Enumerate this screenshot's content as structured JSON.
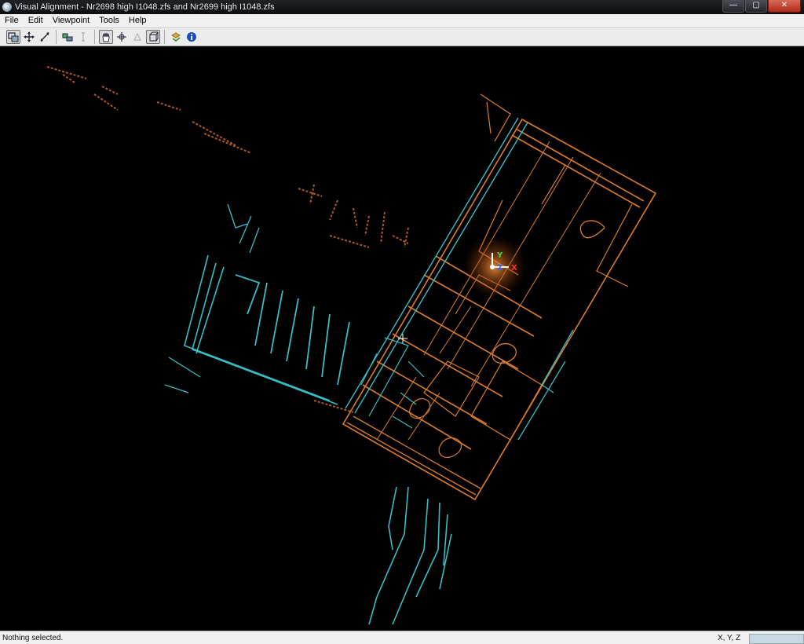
{
  "window": {
    "title": "Visual Alignment - Nr2698 high I1048.zfs and Nr2699 high I1048.zfs",
    "buttons": {
      "minimize": "—",
      "maximize": "▢",
      "close": "✕"
    }
  },
  "menu": [
    "File",
    "Edit",
    "Viewpoint",
    "Tools",
    "Help"
  ],
  "toolbar": {
    "icons": [
      "select-mode-icon",
      "move-icon",
      "rotate-icon",
      "align-icon",
      "cursor-icon",
      "hand-pan-icon",
      "orbit-icon",
      "zoom-icon",
      "box-view-icon",
      "refresh-icon",
      "info-icon"
    ]
  },
  "viewport": {
    "background": "#000000",
    "cloud_a_color": "#e8832f",
    "cloud_b_color": "#3cc8cf",
    "axes": {
      "x": "X",
      "y": "Y",
      "z": "Z"
    }
  },
  "status": {
    "text": "Nothing selected.",
    "coords_label": "X, Y, Z"
  }
}
